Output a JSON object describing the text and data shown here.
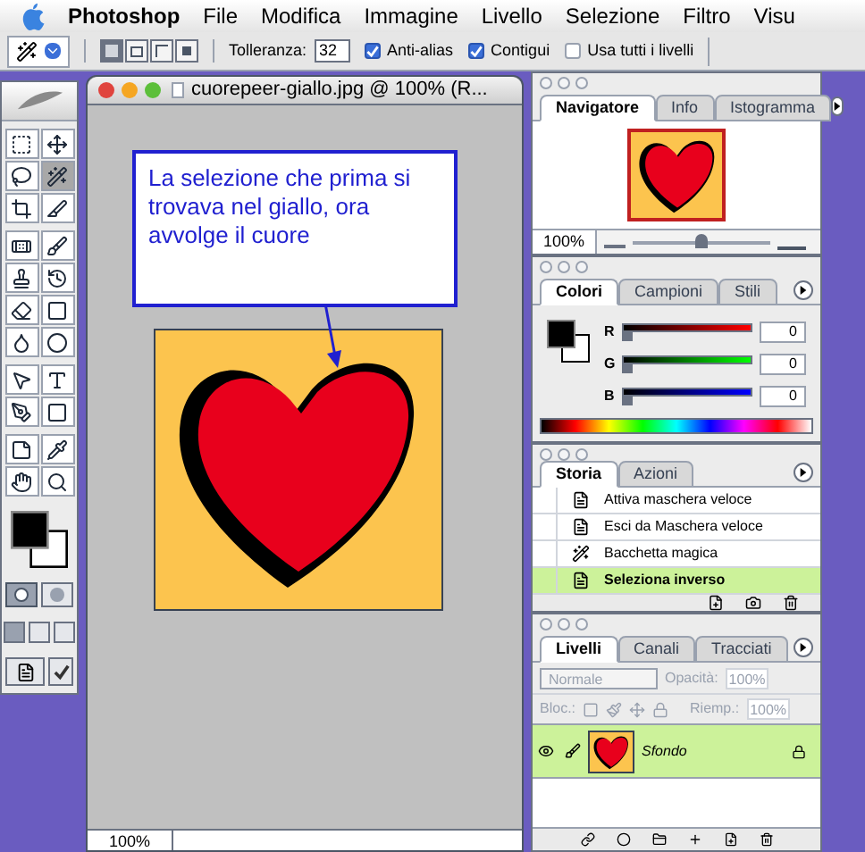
{
  "menubar": {
    "app": "Photoshop",
    "items": [
      "File",
      "Modifica",
      "Immagine",
      "Livello",
      "Selezione",
      "Filtro",
      "Visu"
    ]
  },
  "options_bar": {
    "modes": [
      {
        "kind": "new",
        "selected": true
      },
      {
        "kind": "add",
        "selected": false
      },
      {
        "kind": "subtract",
        "selected": false
      },
      {
        "kind": "intersect",
        "selected": false
      }
    ],
    "tolerance_label": "Tolleranza:",
    "tolerance": "32",
    "checkboxes": [
      {
        "label": "Anti-alias",
        "checked": true
      },
      {
        "label": "Contigui",
        "checked": true
      },
      {
        "label": "Usa tutti i livelli",
        "checked": false
      }
    ]
  },
  "toolbox": {
    "tools": [
      {
        "kind": "marquee",
        "selected": false
      },
      {
        "kind": "move",
        "selected": false
      },
      {
        "kind": "lasso",
        "selected": false
      },
      {
        "kind": "wand",
        "selected": true
      },
      {
        "kind": "crop",
        "selected": false
      },
      {
        "kind": "slice",
        "selected": false
      },
      {
        "kind": "heal",
        "selected": false
      },
      {
        "kind": "brush",
        "selected": false
      },
      {
        "kind": "stamp",
        "selected": false
      },
      {
        "kind": "history",
        "selected": false
      },
      {
        "kind": "eraser",
        "selected": false
      },
      {
        "kind": "gradient",
        "selected": false
      },
      {
        "kind": "blur",
        "selected": false
      },
      {
        "kind": "dodge",
        "selected": false
      },
      {
        "kind": "select",
        "selected": false
      },
      {
        "kind": "type",
        "selected": false
      },
      {
        "kind": "pen",
        "selected": false
      },
      {
        "kind": "shape",
        "selected": false
      },
      {
        "kind": "notes",
        "selected": false
      },
      {
        "kind": "eyedropper",
        "selected": false
      },
      {
        "kind": "hand",
        "selected": false
      },
      {
        "kind": "zoom",
        "selected": false
      }
    ]
  },
  "document": {
    "title": "cuorepeer-giallo.jpg @ 100% (R...",
    "callout": "La selezione che prima si trovava nel giallo, ora avvolge il cuore",
    "zoom": "100%"
  },
  "navigator": {
    "tabs": [
      {
        "label": "Navigatore",
        "selected": true
      },
      {
        "label": "Info",
        "selected": false
      },
      {
        "label": "Istogramma",
        "selected": false
      }
    ],
    "zoom": "100%",
    "level": 0.45
  },
  "colors": {
    "tabs": [
      {
        "label": "Colori",
        "selected": true
      },
      {
        "label": "Campioni",
        "selected": false
      },
      {
        "label": "Stili",
        "selected": false
      }
    ],
    "channels": [
      {
        "name": "R",
        "level": 0,
        "value": "0"
      },
      {
        "name": "G",
        "level": 0,
        "value": "0"
      },
      {
        "name": "B",
        "level": 0,
        "value": "0"
      }
    ]
  },
  "history": {
    "tabs": [
      {
        "label": "Storia",
        "selected": true
      },
      {
        "label": "Azioni",
        "selected": false
      }
    ],
    "items": [
      {
        "label": "Attiva maschera veloce",
        "kind": "command",
        "selected": false
      },
      {
        "label": "Esci da Maschera veloce",
        "kind": "command",
        "selected": false
      },
      {
        "label": "Bacchetta magica",
        "kind": "wand",
        "selected": false
      },
      {
        "label": "Seleziona inverso",
        "kind": "command",
        "selected": true
      }
    ]
  },
  "layers": {
    "tabs": [
      {
        "label": "Livelli",
        "selected": true
      },
      {
        "label": "Canali",
        "selected": false
      },
      {
        "label": "Tracciati",
        "selected": false
      }
    ],
    "blend_mode": "Normale",
    "opacity_label": "Opacità:",
    "opacity": "100%",
    "lock_label": "Bloc.:",
    "fill_label": "Riemp.:",
    "fill": "100%",
    "disabled": true,
    "items": [
      {
        "name": "Sfondo",
        "visible": true,
        "selected": true,
        "locked": true
      }
    ]
  }
}
